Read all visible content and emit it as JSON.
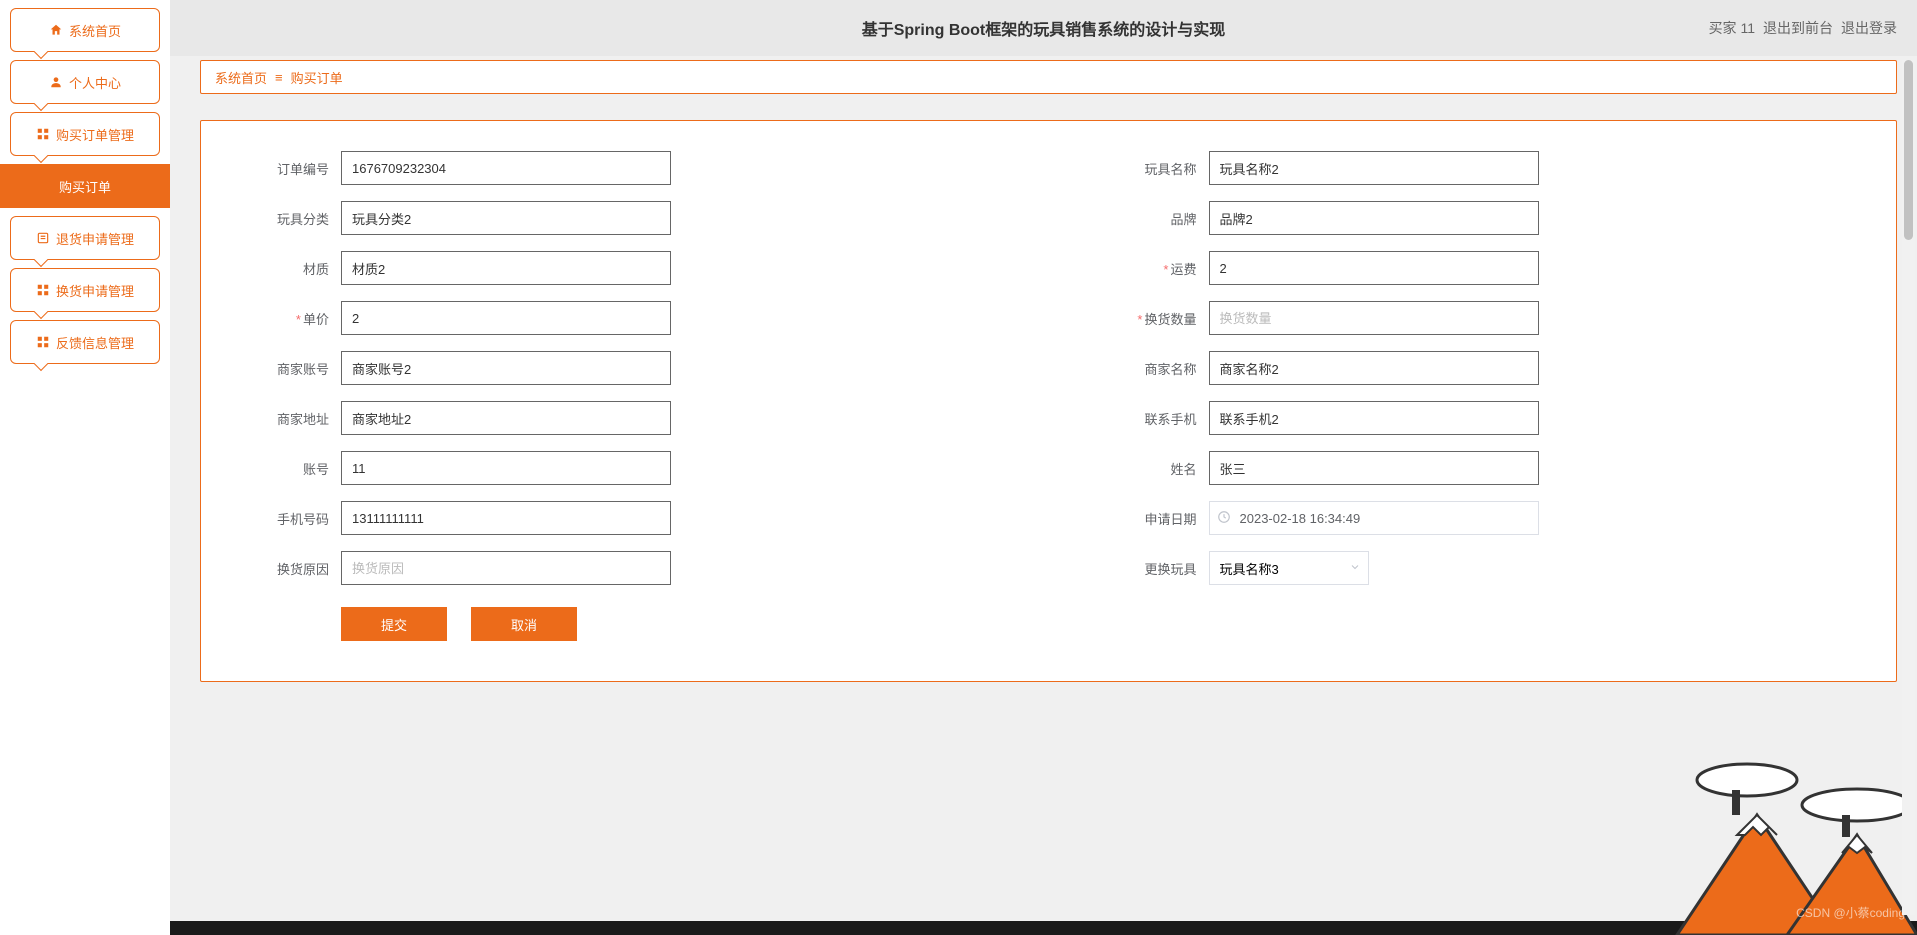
{
  "header": {
    "title": "基于Spring Boot框架的玩具销售系统的设计与实现",
    "user_label": "买家 11",
    "logout_front": "退出到前台",
    "logout": "退出登录"
  },
  "sidebar": {
    "items": [
      {
        "label": "系统首页",
        "icon": "home-icon"
      },
      {
        "label": "个人中心",
        "icon": "user-icon"
      },
      {
        "label": "购买订单管理",
        "icon": "grid-icon"
      },
      {
        "label": "购买订单",
        "icon": "",
        "active": true
      },
      {
        "label": "退货申请管理",
        "icon": "list-icon"
      },
      {
        "label": "换货申请管理",
        "icon": "grid-icon"
      },
      {
        "label": "反馈信息管理",
        "icon": "grid-icon"
      }
    ]
  },
  "breadcrumb": {
    "home": "系统首页",
    "current": "购买订单"
  },
  "form": {
    "order_no": {
      "label": "订单编号",
      "value": "1676709232304"
    },
    "toy_name": {
      "label": "玩具名称",
      "value": "玩具名称2"
    },
    "toy_category": {
      "label": "玩具分类",
      "value": "玩具分类2"
    },
    "brand": {
      "label": "品牌",
      "value": "品牌2"
    },
    "material": {
      "label": "材质",
      "value": "材质2"
    },
    "shipping": {
      "label": "运费",
      "value": "2",
      "required": true
    },
    "price": {
      "label": "单价",
      "value": "2",
      "required": true
    },
    "exchange_qty": {
      "label": "换货数量",
      "placeholder": "换货数量",
      "value": "",
      "required": true
    },
    "seller_account": {
      "label": "商家账号",
      "value": "商家账号2"
    },
    "seller_name": {
      "label": "商家名称",
      "value": "商家名称2"
    },
    "seller_address": {
      "label": "商家地址",
      "value": "商家地址2"
    },
    "contact_phone": {
      "label": "联系手机",
      "value": "联系手机2"
    },
    "account": {
      "label": "账号",
      "value": "11"
    },
    "name": {
      "label": "姓名",
      "value": "张三"
    },
    "phone": {
      "label": "手机号码",
      "value": "13111111111"
    },
    "apply_date": {
      "label": "申请日期",
      "value": "2023-02-18 16:34:49"
    },
    "exchange_reason": {
      "label": "换货原因",
      "placeholder": "换货原因",
      "value": ""
    },
    "replace_toy": {
      "label": "更换玩具",
      "value": "玩具名称3"
    }
  },
  "actions": {
    "submit": "提交",
    "cancel": "取消"
  },
  "watermark": "CSDN @小蔡coding"
}
